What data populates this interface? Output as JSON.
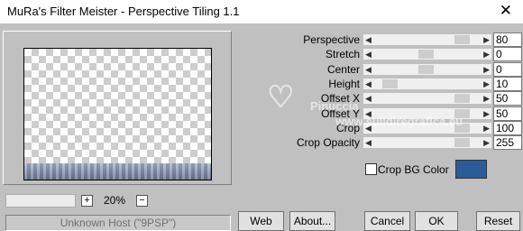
{
  "window": {
    "title": "MuRa's Filter Meister - Perspective Tiling 1.1"
  },
  "preview": {
    "zoom": "20%"
  },
  "status": {
    "text": "Unknown Host (\"9PSP\")"
  },
  "params": [
    {
      "label": "Perspective",
      "value": "80",
      "pos": 0.8
    },
    {
      "label": "Stretch",
      "value": "0",
      "pos": 0.45
    },
    {
      "label": "Center",
      "value": "0",
      "pos": 0.45
    },
    {
      "label": "Height",
      "value": "10",
      "pos": 0.1
    },
    {
      "label": "Offset X",
      "value": "50",
      "pos": 0.8
    },
    {
      "label": "Offset Y",
      "value": "50",
      "pos": 0.8
    },
    {
      "label": "Crop",
      "value": "100",
      "pos": 0.8
    },
    {
      "label": "Crop Opacity",
      "value": "255",
      "pos": 0.8
    }
  ],
  "crop_bg": {
    "label": "Crop BG Color",
    "color": "#2a5c9a"
  },
  "buttons": {
    "web": "Web",
    "about": "About...",
    "cancel": "Cancel",
    "ok": "OK",
    "reset": "Reset"
  },
  "zoom_buttons": {
    "plus": "+",
    "minus": "−"
  },
  "watermark": {
    "brand": "Pinuccia",
    "url": "www.sulldiregrafica.eu"
  }
}
